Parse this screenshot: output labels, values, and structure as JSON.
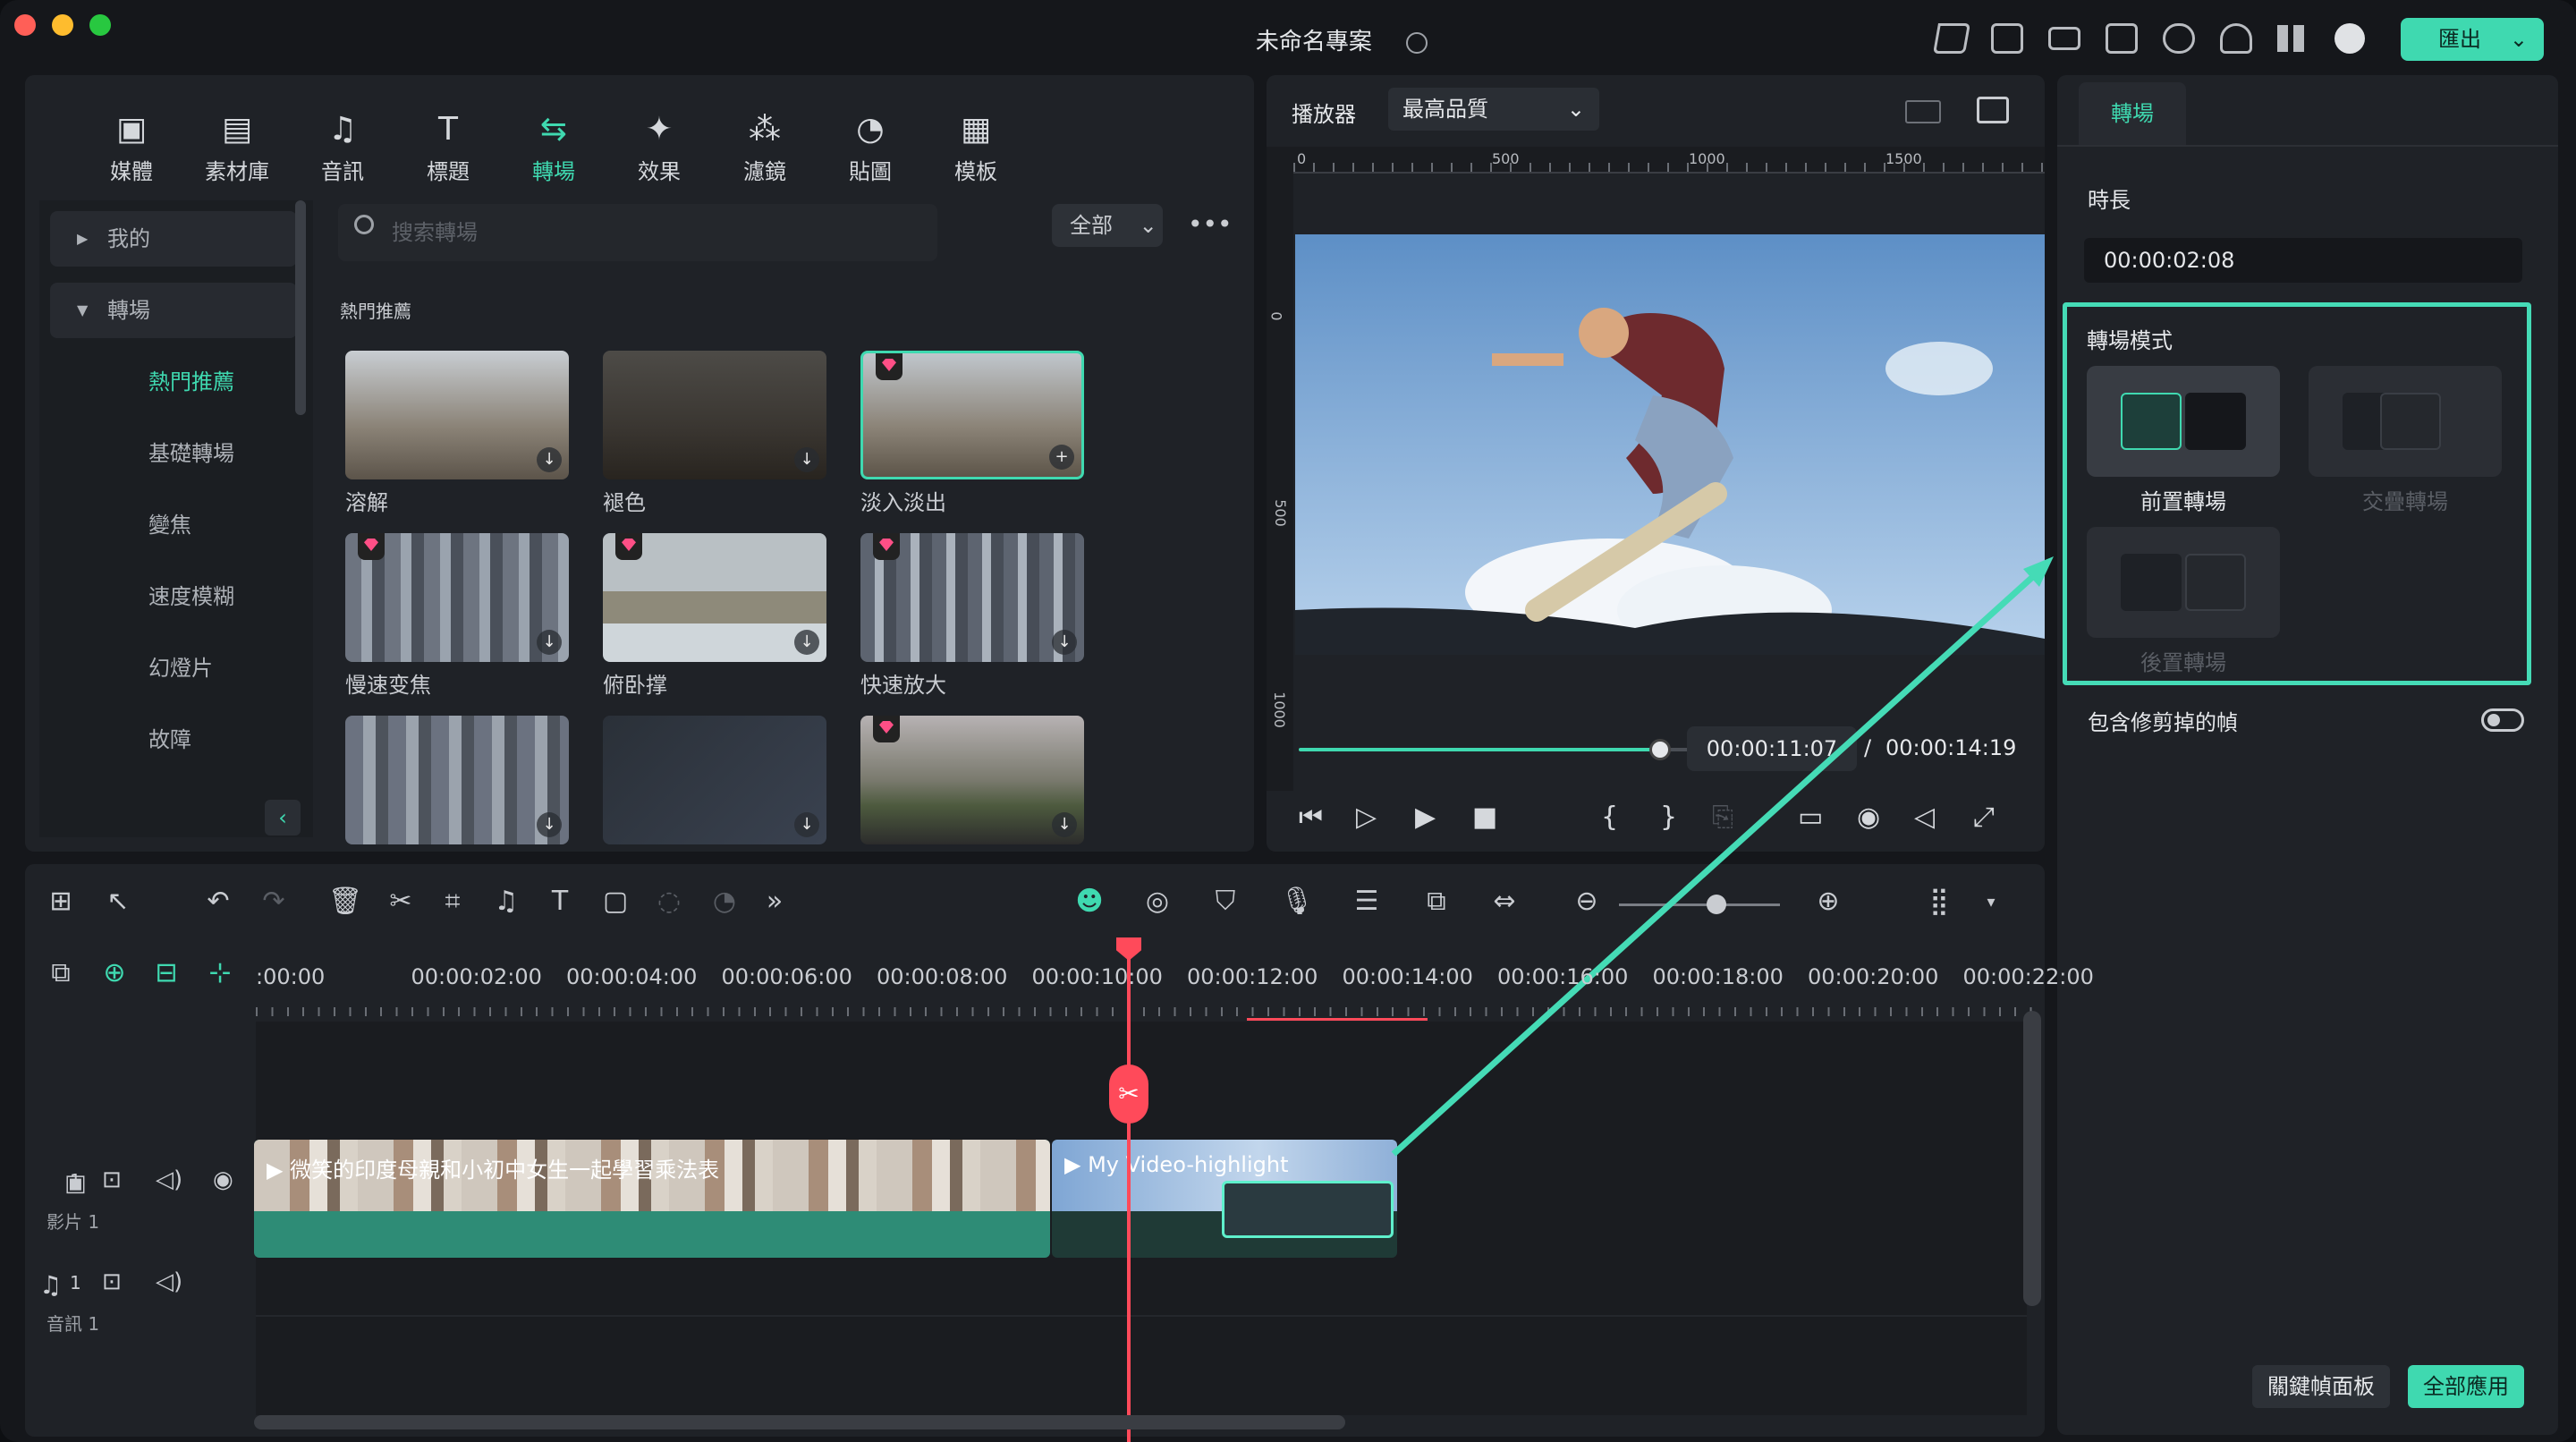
{
  "window": {
    "title": "未命名專案",
    "export_label": "匯出"
  },
  "library": {
    "tabs": [
      {
        "label": "媒體",
        "icon": "media-icon"
      },
      {
        "label": "素材庫",
        "icon": "stock-icon"
      },
      {
        "label": "音訊",
        "icon": "music-icon"
      },
      {
        "label": "標題",
        "icon": "title-icon"
      },
      {
        "label": "轉場",
        "icon": "transition-icon",
        "active": true
      },
      {
        "label": "效果",
        "icon": "effects-icon"
      },
      {
        "label": "濾鏡",
        "icon": "filters-icon"
      },
      {
        "label": "貼圖",
        "icon": "sticker-icon"
      },
      {
        "label": "模板",
        "icon": "template-icon"
      }
    ],
    "nav": {
      "mine": "我的",
      "transitions": "轉場",
      "items": [
        "熱門推薦",
        "基礎轉場",
        "變焦",
        "速度模糊",
        "幻燈片",
        "故障"
      ]
    },
    "search_placeholder": "搜索轉場",
    "filter_label": "全部",
    "section_title": "熱門推薦",
    "thumbnails": [
      {
        "label": "溶解",
        "premium": false
      },
      {
        "label": "褪色",
        "premium": false
      },
      {
        "label": "淡入淡出",
        "premium": true
      },
      {
        "label": "慢速变焦",
        "premium": true
      },
      {
        "label": "俯卧撑",
        "premium": true
      },
      {
        "label": "快速放大",
        "premium": true
      },
      {
        "label": "",
        "premium": false
      },
      {
        "label": "",
        "premium": false
      },
      {
        "label": "",
        "premium": true
      }
    ]
  },
  "player": {
    "label": "播放器",
    "quality": "最高品質",
    "ruler_top": [
      "0",
      "500",
      "1000",
      "1500"
    ],
    "ruler_left": [
      "0",
      "500",
      "1000"
    ],
    "current_time": "00:00:11:07",
    "separator": "/",
    "total_time": "00:00:14:19",
    "progress": 0.79
  },
  "inspector": {
    "tab": "轉場",
    "duration_label": "時長",
    "duration_value": "00:00:02:08",
    "mode_label": "轉場模式",
    "modes": [
      "前置轉場",
      "交疊轉場",
      "後置轉場"
    ],
    "include_label": "包含修剪掉的幀",
    "keyframe_btn": "關鍵幀面板",
    "apply_all_btn": "全部應用"
  },
  "timeline": {
    "ticks": [
      ":00:00",
      "00:00:02:00",
      "00:00:04:00",
      "00:00:06:00",
      "00:00:08:00",
      "00:00:10:00",
      "00:00:12:00",
      "00:00:14:00",
      "00:00:16:00",
      "00:00:18:00",
      "00:00:20:00",
      "00:00:22:00"
    ],
    "video_track": {
      "num": "1",
      "name": "影片 1"
    },
    "audio_track": {
      "num": "1",
      "name": "音訊 1"
    },
    "clip1": "微笑的印度母親和小初中女生一起學習乘法表",
    "clip2": "My Video-highlight"
  },
  "colors": {
    "accent": "#3fd9b0",
    "playhead": "#ff4a5a",
    "premium": "#ff4f86"
  }
}
